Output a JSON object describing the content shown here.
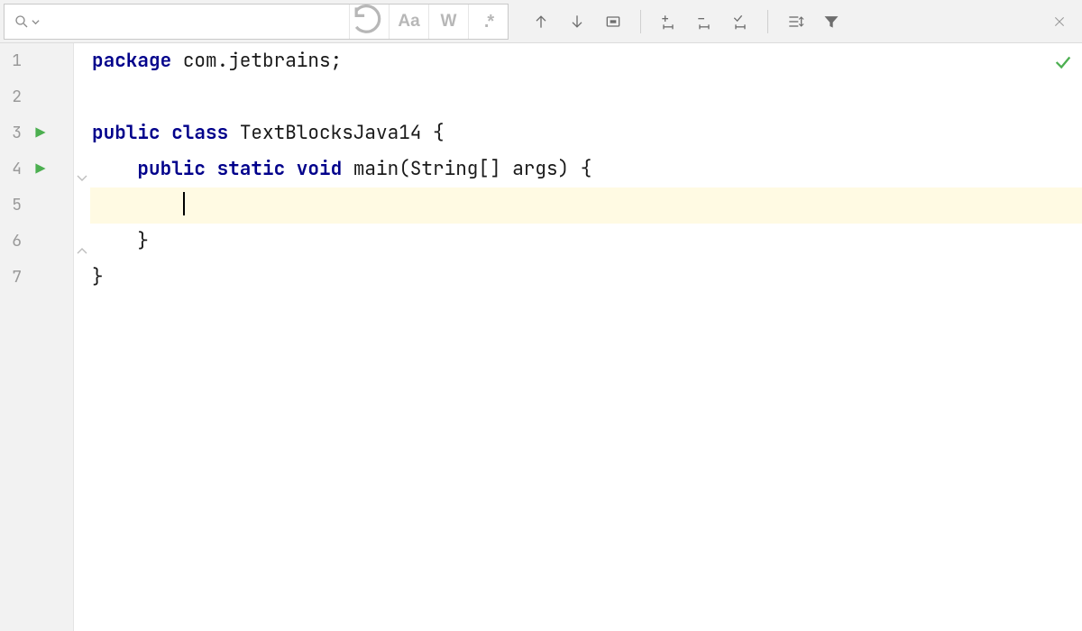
{
  "search": {
    "value": "",
    "placeholder": "",
    "case_label": "Aa",
    "words_label": "W",
    "regex_label": ".*"
  },
  "toolbar": {
    "prev": "Previous Occurrence",
    "next": "Next Occurrence",
    "select_all": "Select All Occurrences",
    "add_selection": "Add Selection for Next Occurrence",
    "remove_selection": "Unselect Occurrence",
    "select_occurrences": "Select All Occurrences",
    "find_in_selection": "Search in Selection",
    "filter": "Filter"
  },
  "gutter": {
    "line_numbers": [
      "1",
      "2",
      "3",
      "4",
      "5",
      "6",
      "7"
    ],
    "run_markers": [
      3,
      4
    ],
    "fold_open_rows": [
      4
    ],
    "fold_close_rows": [
      6
    ]
  },
  "code": {
    "highlighted_line": 5,
    "lines": [
      {
        "segments": [
          {
            "t": "package ",
            "c": "kw"
          },
          {
            "t": "com.jetbrains;",
            "c": "plain"
          }
        ]
      },
      {
        "segments": []
      },
      {
        "segments": [
          {
            "t": "public class ",
            "c": "kw"
          },
          {
            "t": "TextBlocksJava14 {",
            "c": "plain"
          }
        ]
      },
      {
        "segments": [
          {
            "t": "    ",
            "c": "plain"
          },
          {
            "t": "public static void ",
            "c": "kw"
          },
          {
            "t": "main(String[] args) {",
            "c": "plain"
          }
        ]
      },
      {
        "segments": [
          {
            "t": "        ",
            "c": "plain"
          }
        ],
        "caret": true
      },
      {
        "segments": [
          {
            "t": "    }",
            "c": "plain"
          }
        ]
      },
      {
        "segments": [
          {
            "t": "}",
            "c": "plain"
          }
        ]
      }
    ]
  },
  "status": {
    "analysis_ok": true
  }
}
